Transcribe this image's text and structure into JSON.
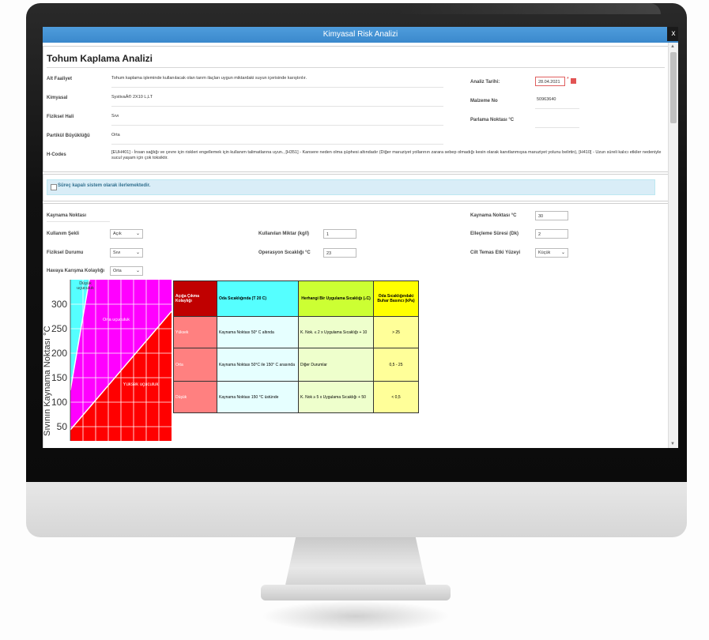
{
  "window": {
    "title": "Kimyasal Risk Analizi",
    "close_label": "x"
  },
  "section1": {
    "heading": "Tohum Kaplama Analizi",
    "fields": [
      {
        "label": "Alt Faaliyet",
        "value": "Tohum kaplama işleminde kullanılacak olan tarım ilaçları uygun miktardaki suyun içerisinde karıştırılır."
      },
      {
        "label": "Kimyasal",
        "value": "SystivaÂ® 2X10 L,LT"
      },
      {
        "label": "Fiziksel Hali",
        "value": "Sıvı"
      },
      {
        "label": "Partikül Büyüklüğü",
        "value": "Orta"
      },
      {
        "label": "H-Codes",
        "value": "[EUH401] - İnsan sağlığı ve çevre için riskleri engellemek için kullanım talimatlarına uyun., [H351] - Kansere neden olma şüphesi altındadır (Diğer maruziyet yollarının zarara sebep olmadığı kesin olarak kanıtlanmışsa maruziyet yolunu belirtin), [H410] - Uzun süreli kalıcı etkiler nedeniyle sucul yaşam için çok toksiktir."
      }
    ],
    "right_fields": [
      {
        "label": "Analiz Tarihi:",
        "value": "28.04.2021",
        "required_mark": "*"
      },
      {
        "label": "Malzeme No",
        "value": "50963640"
      },
      {
        "label": "Parlama Noktası °C",
        "value": ""
      }
    ]
  },
  "section2": {
    "checkbox_label": "Süreç kapalı sistem olarak ilerlemektedir."
  },
  "section3": {
    "kaynama_label": "Kaynama Noktası",
    "kullanim_sekli": {
      "label": "Kullanım Şekli",
      "value": "Açık"
    },
    "fiziksel_durumu": {
      "label": "Fiziksel Durumu",
      "value": "Sıvı"
    },
    "havaya_karisma": {
      "label": "Havaya Karışma Kolaylığı",
      "value": "Orta"
    },
    "kullanilan_miktar": {
      "label": "Kullanılan Miktar (kg/l)",
      "value": "1"
    },
    "operasyon_sicakligi": {
      "label": "Operasyon Sıcaklığı °C",
      "value": "23"
    },
    "kaynama_noktasi_c": {
      "label": "Kaynama Noktası °C",
      "value": "30"
    },
    "etkilesme_suresi": {
      "label": "Elleçleme Süresi (Dk)",
      "value": "2"
    },
    "cilt_temas": {
      "label": "Cilt Temas Etki Yüzeyi",
      "value": "Küçük"
    }
  },
  "chart": {
    "ylabel": "Sıvının Kaynama Noktası °C",
    "ticks": [
      "300",
      "250",
      "200",
      "150",
      "100",
      "50"
    ],
    "region_low": "Düşük uçuculuk",
    "region_mid": "Orta uçuculuk",
    "region_high": "Yüksek uçuculuk"
  },
  "table": {
    "headers": [
      "Açığa Çıkma Kolaylığı",
      "Oda Sıcaklığında (T 20 C)",
      "Herhangi Bir Uygulama Sıcaklığı (₀C)",
      "Oda Sıcaklığındaki Buhar Basıncı (kPa)"
    ],
    "rows": [
      [
        "Yüksek",
        "Kaynama Noktası 50° C altında",
        "K. Nok. ≤ 2 x Uygulama Sıcaklığı + 10",
        "> 25"
      ],
      [
        "Orta",
        "Kaynama Noktası 50°C ile 150° C arasında",
        "Diğer Durumlar",
        "0,5 - 25"
      ],
      [
        "Düşük",
        "Kaynama Noktası 150 °C üstünde",
        "K. Nok ≥ 5 x Uygulama Sıcaklığı + 50",
        "< 0,5"
      ]
    ]
  },
  "colors": {
    "titlebar": "#3d8dd0",
    "magenta": "#ff00ff",
    "red": "#ff0000",
    "cyan": "#55ffff",
    "yellow": "#ffff00",
    "lime": "#ccff33"
  }
}
